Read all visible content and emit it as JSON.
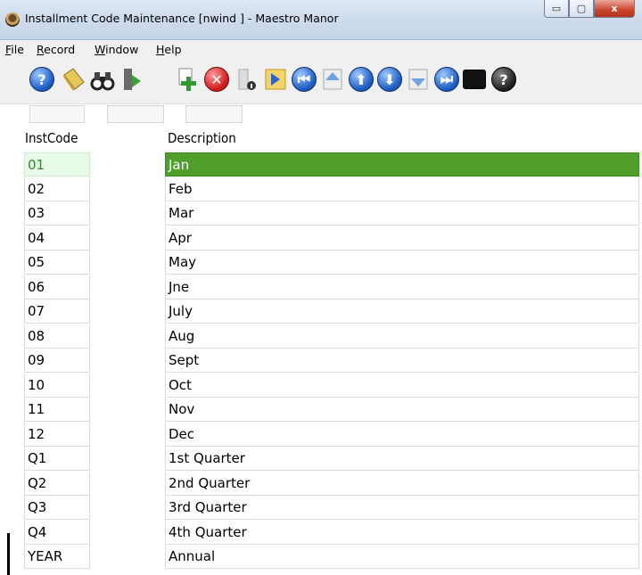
{
  "window": {
    "title": "Installment Code Maintenance [nwind  ] - Maestro Manor",
    "buttons": {
      "minimize": "▭",
      "maximize": "▢",
      "close": "x"
    }
  },
  "menu": {
    "items": [
      "File",
      "Record",
      "Window",
      "Help"
    ]
  },
  "toolbar": {
    "icons": [
      "help-icon",
      "note-icon",
      "binoculars-icon",
      "door-exit-icon",
      "add-record-icon",
      "delete-record-icon",
      "info-icon",
      "refresh-icon",
      "first-record-icon",
      "page-up-icon",
      "previous-record-icon",
      "next-record-icon",
      "page-down-icon",
      "last-record-icon",
      "terminal-icon",
      "context-help-icon"
    ],
    "help_glyph": "?",
    "context_help_glyph": "?"
  },
  "grid": {
    "headers": {
      "code": "InstCode",
      "description": "Description"
    },
    "rows": [
      {
        "code": "01",
        "description": "Jan"
      },
      {
        "code": "02",
        "description": "Feb"
      },
      {
        "code": "03",
        "description": "Mar"
      },
      {
        "code": "04",
        "description": "Apr"
      },
      {
        "code": "05",
        "description": "May"
      },
      {
        "code": "06",
        "description": "Jne"
      },
      {
        "code": "07",
        "description": "July"
      },
      {
        "code": "08",
        "description": "Aug"
      },
      {
        "code": "09",
        "description": "Sept"
      },
      {
        "code": "10",
        "description": "Oct"
      },
      {
        "code": "11",
        "description": "Nov"
      },
      {
        "code": "12",
        "description": "Dec"
      },
      {
        "code": "Q1",
        "description": "1st Quarter"
      },
      {
        "code": "Q2",
        "description": "2nd Quarter"
      },
      {
        "code": "Q3",
        "description": "3rd Quarter"
      },
      {
        "code": "Q4",
        "description": "4th Quarter"
      },
      {
        "code": "YEAR",
        "description": "Annual"
      }
    ],
    "selected_index": 0
  },
  "colors": {
    "selection": "#4f9d2a",
    "selection_code_bg": "#e8fbe8"
  }
}
